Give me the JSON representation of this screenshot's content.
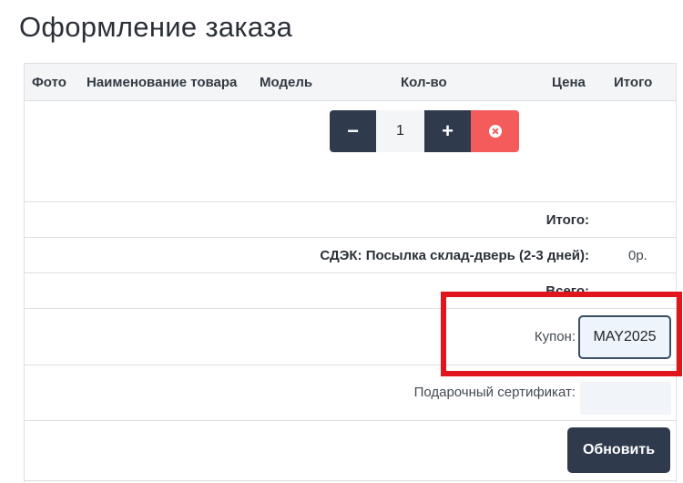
{
  "page": {
    "title": "Оформление заказа"
  },
  "cart_table": {
    "headers": {
      "photo": "Фото",
      "name": "Наименование товара",
      "model": "Модель",
      "qty": "Кол-во",
      "price": "Цена",
      "total": "Итого"
    },
    "item": {
      "minus_symbol": "−",
      "quantity": "1",
      "plus_symbol": "+"
    }
  },
  "totals": {
    "subtotal_label": "Итого:",
    "shipping_label": "СДЭК: Посылка склад-дверь (2-3 дней):",
    "shipping_value": "0р.",
    "grand_total_label": "Всего:"
  },
  "coupon": {
    "label": "Купон:",
    "value": "MAY2025"
  },
  "gift_certificate": {
    "label": "Подарочный сертификат:",
    "value": ""
  },
  "actions": {
    "update_label": "Обновить"
  },
  "colors": {
    "dark_button": "#2f3b4d",
    "remove_button": "#f45b5b",
    "highlight": "#e0161c"
  }
}
